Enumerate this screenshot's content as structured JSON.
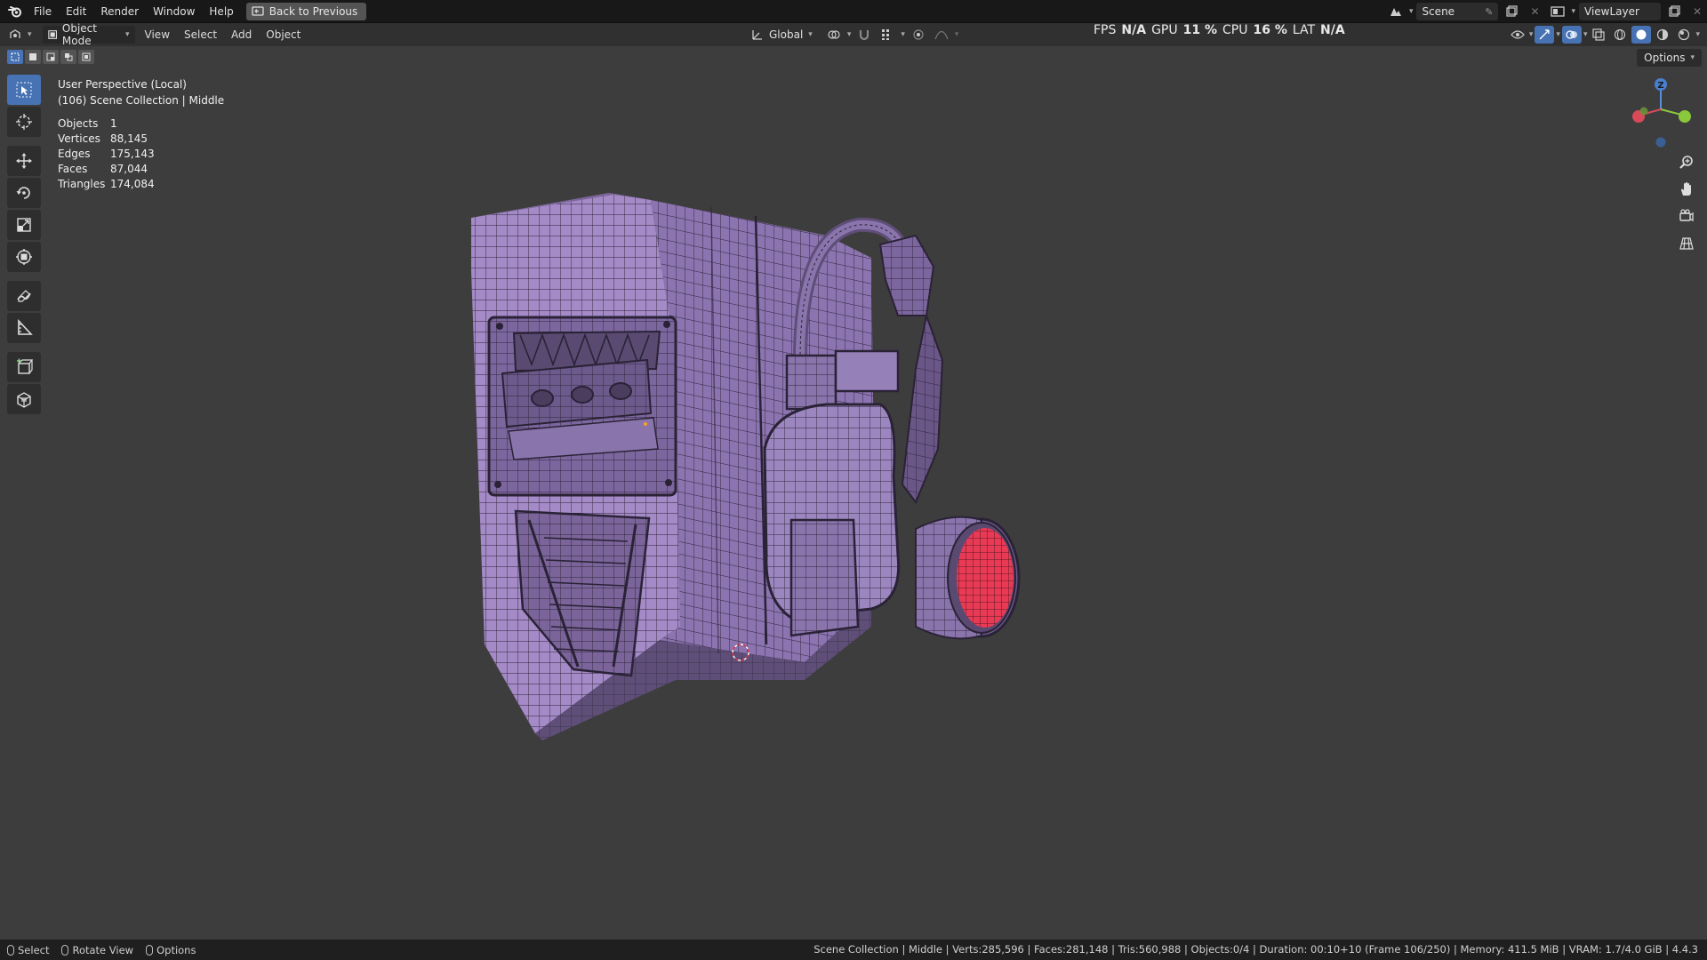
{
  "menu": {
    "file": "File",
    "edit": "Edit",
    "render": "Render",
    "window": "Window",
    "help": "Help",
    "back_button": "Back to Previous"
  },
  "top_right": {
    "scene": "Scene",
    "view_layer": "ViewLayer"
  },
  "header": {
    "mode": "Object Mode",
    "view": "View",
    "select": "Select",
    "add": "Add",
    "object": "Object",
    "orientation": "Global",
    "options": "Options"
  },
  "perf": {
    "fps_label": "FPS",
    "fps_value": "N/A",
    "gpu_label": "GPU",
    "gpu_value": "11 %",
    "cpu_label": "CPU",
    "cpu_value": "16 %",
    "lat_label": "LAT",
    "lat_value": "N/A"
  },
  "viewport": {
    "perspective": "User Perspective (Local)",
    "collection": "(106) Scene Collection | Middle",
    "stats": [
      {
        "label": "Objects",
        "value": "1"
      },
      {
        "label": "Vertices",
        "value": "88,145"
      },
      {
        "label": "Edges",
        "value": "175,143"
      },
      {
        "label": "Faces",
        "value": "87,044"
      },
      {
        "label": "Triangles",
        "value": "174,084"
      }
    ],
    "gizmo_z": "Z"
  },
  "status": {
    "select": "Select",
    "rotate": "Rotate View",
    "options": "Options",
    "info": "Scene Collection | Middle | Verts:285,596 | Faces:281,148 | Tris:560,988 | Objects:0/4 | Duration: 00:10+10 (Frame 106/250) | Memory: 411.5 MiB | VRAM: 1.7/4.0 GiB | 4.4.3"
  },
  "colors": {
    "accent": "#4772b3",
    "mesh": "#9b82bf",
    "lens": "#e83a55"
  }
}
